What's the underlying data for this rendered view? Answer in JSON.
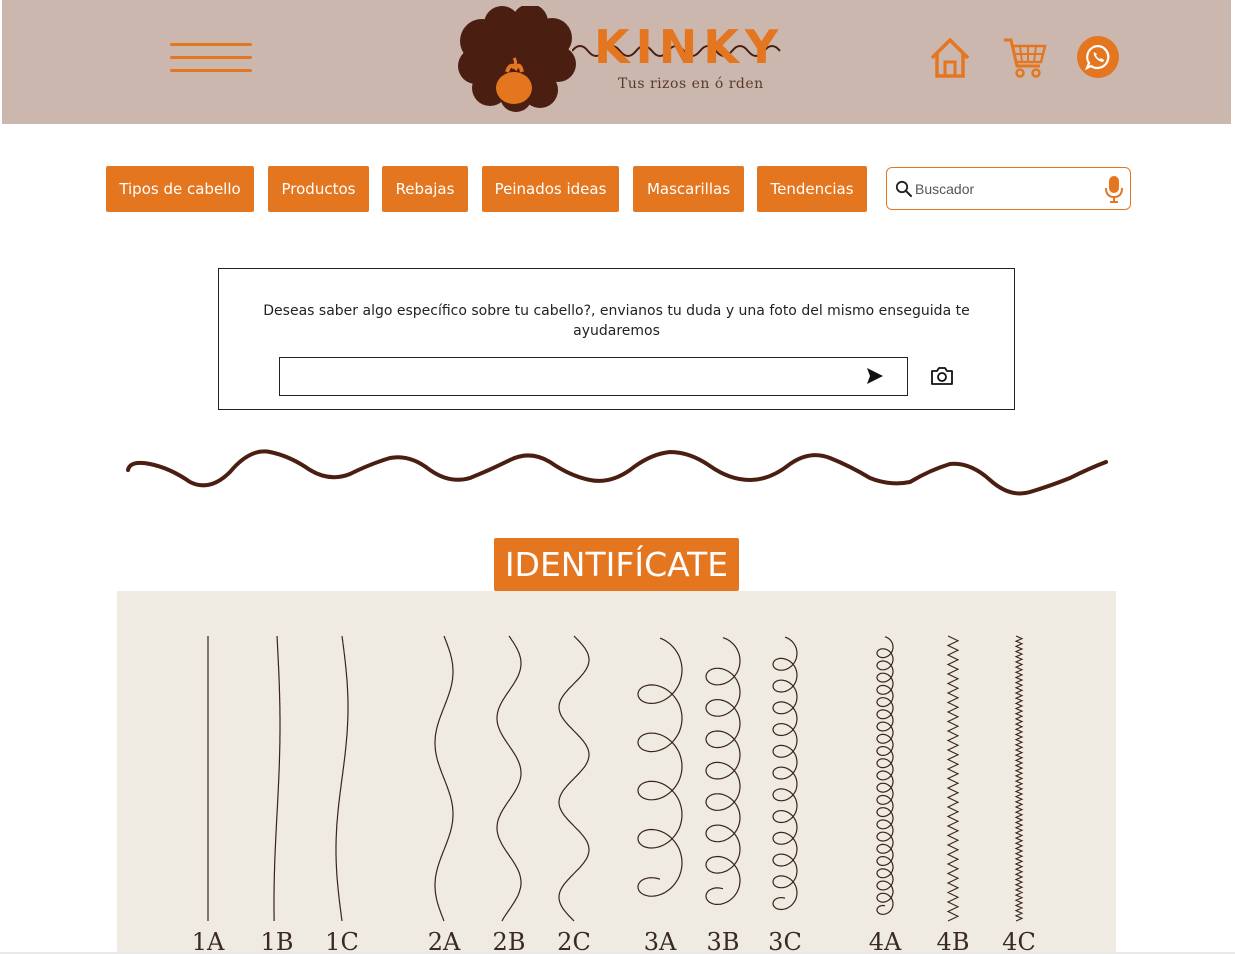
{
  "header": {
    "brand": "KINKY",
    "tagline": "Tus rizos en ó rden",
    "icons": [
      "menu-icon",
      "home-icon",
      "cart-icon",
      "whatsapp-icon"
    ]
  },
  "nav": {
    "items": [
      {
        "label": "Tipos de cabello"
      },
      {
        "label": "Productos"
      },
      {
        "label": "Rebajas"
      },
      {
        "label": "Peinados ideas"
      },
      {
        "label": "Mascarillas"
      },
      {
        "label": "Tendencias"
      }
    ],
    "search_placeholder": "Buscador"
  },
  "question": {
    "text": "Deseas saber algo específico sobre tu cabello?, envianos tu duda y una foto del mismo enseguida te ayudaremos",
    "input_value": ""
  },
  "section": {
    "title": "IDENTIFÍCATE"
  },
  "hair_types": [
    "1A",
    "1B",
    "1C",
    "2A",
    "2B",
    "2C",
    "3A",
    "3B",
    "3C",
    "4A",
    "4B",
    "4C"
  ],
  "colors": {
    "accent": "#e57620",
    "header_bg": "#cbb7ae",
    "dark_brown": "#4a1e10",
    "chart_bg": "#efebe2"
  }
}
